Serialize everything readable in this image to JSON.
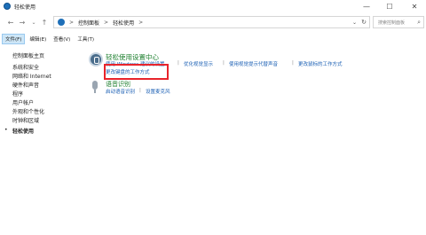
{
  "window": {
    "title": "轻松使用",
    "minimize": "—",
    "maximize": "☐",
    "close": "✕"
  },
  "nav": {
    "back": "←",
    "forward": "→",
    "dropdown": "⌄",
    "up": "↑"
  },
  "address": {
    "crumbs": [
      "控制面板",
      "轻松使用"
    ],
    "separator": ">",
    "dropdown": "⌄",
    "refresh": "↻"
  },
  "search": {
    "placeholder": "搜索控制面板",
    "icon": "⌕"
  },
  "menu": {
    "items": [
      "文件(F)",
      "编辑(E)",
      "查看(V)",
      "工具(T)"
    ],
    "active_index": 0
  },
  "sidebar": {
    "home": "控制面板主页",
    "items": [
      "系统和安全",
      "网络和 Internet",
      "硬件和声音",
      "程序",
      "用户帐户",
      "外观和个性化",
      "时钟和区域",
      "轻松使用"
    ],
    "current_index": 7,
    "bullet": "•"
  },
  "content": {
    "section1_title": "轻松使用设置中心",
    "section1_links": [
      "使用 Windows 建议的设置",
      "优化视觉显示",
      "使用视觉提示代替声音",
      "更改鼠标的工作方式"
    ],
    "section1_link2": "更改键盘的工作方式",
    "section2_title": "语音识别",
    "section2_links": [
      "启动语音识别",
      "设置麦克风"
    ],
    "separator": "|"
  },
  "colors": {
    "accent_green": "#1d7f2e",
    "link_blue": "#1a5fb4",
    "highlight_red": "#e8242b"
  }
}
